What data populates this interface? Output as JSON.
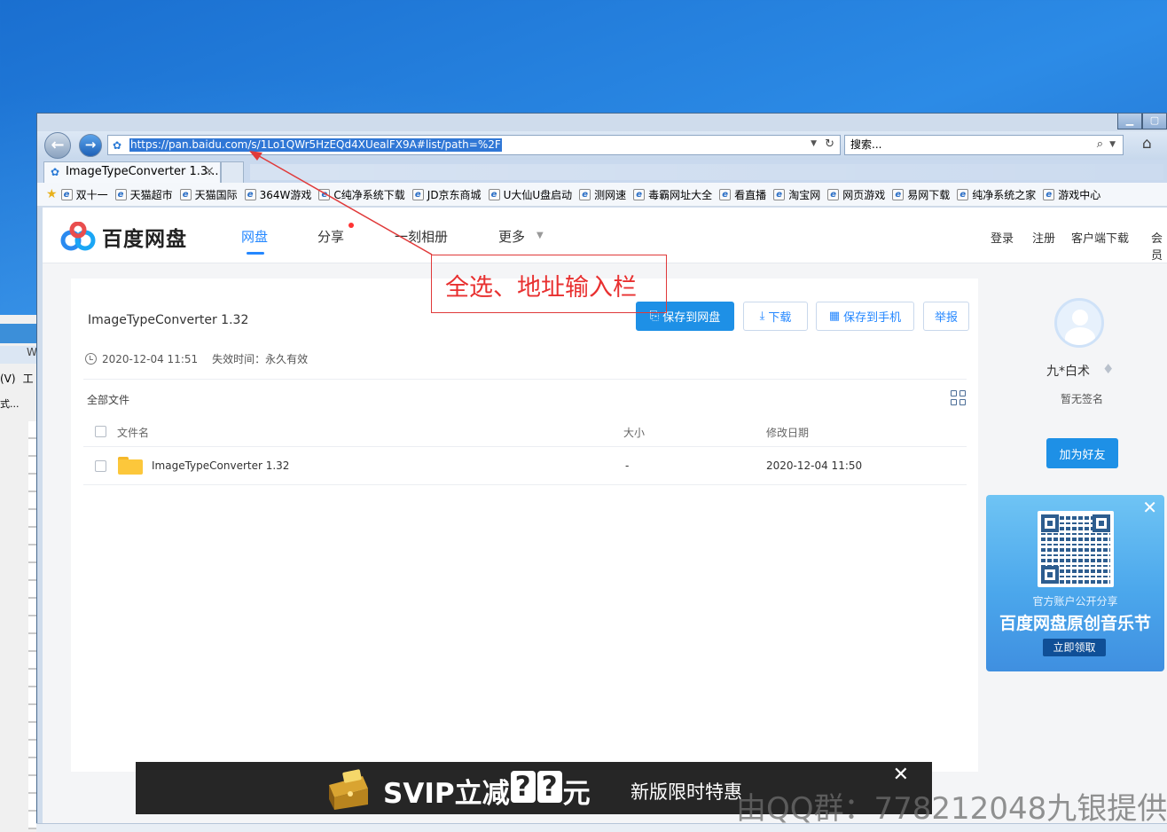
{
  "browser": {
    "address_url": "https://pan.baidu.com/s/1Lo1QWr5HzEQd4XUealFX9A#list/path=%2F",
    "search_placeholder": "搜索...",
    "tab_title": "ImageTypeConverter 1.3...",
    "tab_close": "×",
    "window_buttons": [
      "▁",
      "▢"
    ]
  },
  "favorites": [
    "双十一",
    "天猫超市",
    "天猫国际",
    "364W游戏",
    "C纯净系统下载",
    "JD京东商城",
    "U大仙U盘启动",
    "测网速",
    "毒霸网址大全",
    "看直播",
    "淘宝网",
    "网页游戏",
    "易网下载",
    "纯净系统之家",
    "游戏中心"
  ],
  "site_nav": {
    "logo_text": "百度网盘",
    "links": [
      "网盘",
      "分享",
      "一刻相册",
      "更多"
    ],
    "right_links": [
      "登录",
      "注册",
      "客户端下载",
      "会员"
    ]
  },
  "share": {
    "title": "ImageTypeConverter 1.32",
    "created": "2020-12-04 11:51",
    "expire": "失效时间：永久有效",
    "buttons": {
      "save": "保存到网盘",
      "download": "下载",
      "save_phone": "保存到手机",
      "report": "举报"
    },
    "all_files": "全部文件",
    "columns": {
      "name": "文件名",
      "size": "大小",
      "modified": "修改日期"
    },
    "rows": [
      {
        "name": "ImageTypeConverter 1.32",
        "size": "-",
        "modified": "2020-12-04 11:50"
      }
    ]
  },
  "annotation": {
    "text": "全选、地址输入栏"
  },
  "profile": {
    "username": "九*白术",
    "signature": "暂无签名",
    "add_friend": "加为好友"
  },
  "promo": {
    "line1": "官方账户公开分享",
    "line2": "百度网盘原创音乐节",
    "cta": "立即领取"
  },
  "ad": {
    "prefix": "SVIP立减",
    "q1": "?",
    "q2": "?",
    "suffix": "元",
    "tagline": "新版限时特惠",
    "close": "✕"
  },
  "watermark": "由QQ群：778212048九银提供",
  "background_window": {
    "labels": [
      "W",
      "(V)",
      "工",
      "式..."
    ]
  },
  "colors": {
    "accent": "#2487ff",
    "primary_button": "#1e90e6",
    "annotation": "#e83030"
  }
}
